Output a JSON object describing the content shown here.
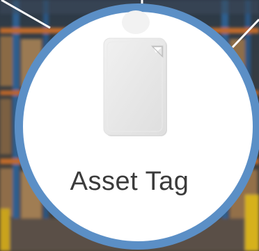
{
  "product": {
    "label": "Asset Tag",
    "icon": "asset-tag-icon"
  },
  "colors": {
    "ring": "#5b8fc6",
    "badge_fill": "#ffffff",
    "label_text": "#3b3b3b",
    "connector_lines": "#ffffff"
  }
}
